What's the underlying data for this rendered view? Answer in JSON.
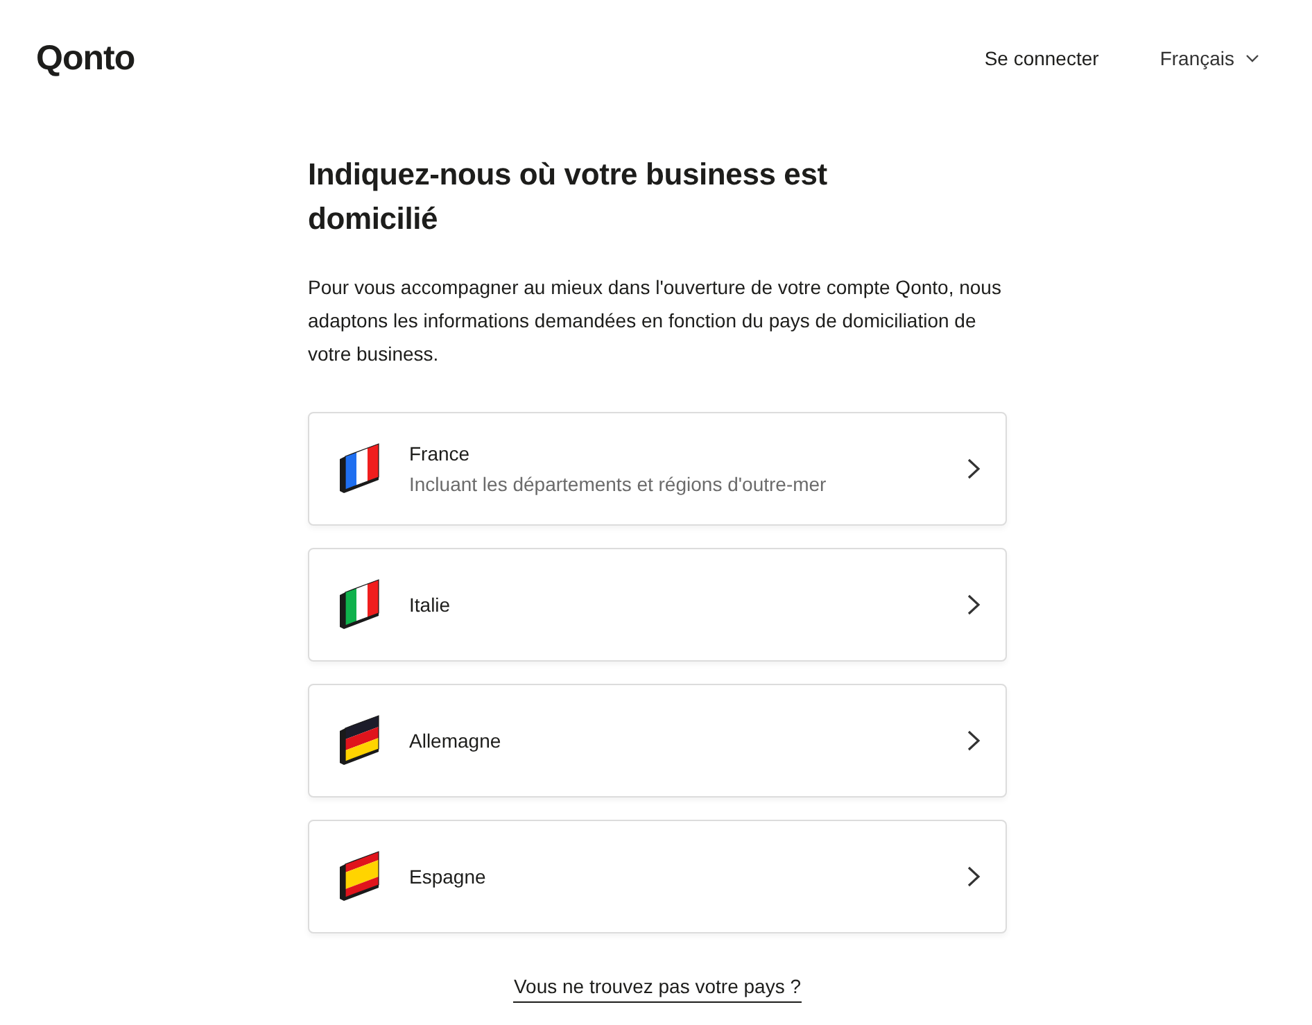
{
  "header": {
    "logo": "Qonto",
    "login": "Se connecter",
    "language": "Français"
  },
  "title": "Indiquez-nous où votre business est domicilié",
  "intro": "Pour vous accompagner au mieux dans l'ouverture de votre compte Qonto, nous adaptons les informations demandées en fonction du pays de domiciliation de votre business.",
  "countries": [
    {
      "name": "France",
      "subtitle": "Incluant les départements et régions d'outre-mer",
      "kind": "france"
    },
    {
      "name": "Italie",
      "kind": "italy"
    },
    {
      "name": "Allemagne",
      "kind": "germany"
    },
    {
      "name": "Espagne",
      "kind": "spain"
    }
  ],
  "help_link": "Vous ne trouvez pas votre pays ?"
}
